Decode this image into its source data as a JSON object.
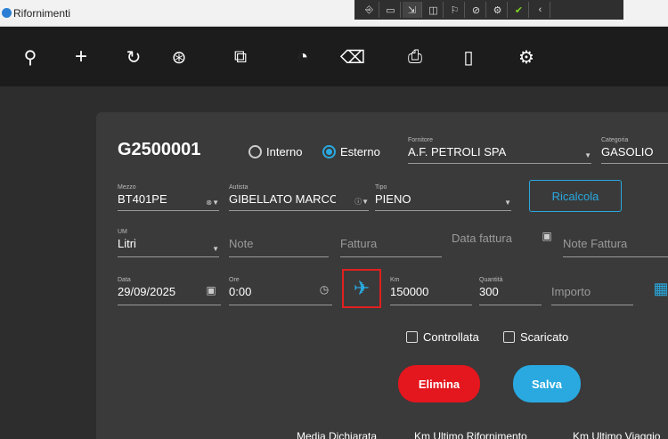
{
  "window": {
    "title": "Rifornimenti"
  },
  "tray": {
    "items": [
      "⎆",
      "▭",
      "⇲",
      "◫",
      "⚐",
      "⊘",
      "⚙",
      "✔",
      "‹"
    ]
  },
  "toolbar": {
    "search_icon": "⚲",
    "add_icon": "+",
    "refresh_icon": "↻",
    "copy_icon": "⊛",
    "attach_icon": "⧉",
    "history_icon": "◔",
    "trash_icon": "⌫",
    "print_icon": "⎙",
    "mobile_icon": "▯",
    "settings_icon": "⚙"
  },
  "form": {
    "code": "G2500001",
    "type_options": [
      "Interno",
      "Esterno"
    ],
    "type_selected": "Esterno",
    "fornitore": {
      "label": "Fornitore",
      "value": "A.F. PETROLI SPA"
    },
    "categoria": {
      "label": "Categoria",
      "value": "GASOLIO"
    },
    "mezzo": {
      "label": "Mezzo",
      "value": "BT401PE"
    },
    "autista": {
      "label": "Autista",
      "value": "GIBELLATO MARCO"
    },
    "tipo": {
      "label": "Tipo",
      "value": "PIENO"
    },
    "ricalcola_label": "Ricalcola",
    "um": {
      "label": "UM",
      "value": "Litri"
    },
    "note_placeholder": "Note",
    "fattura_placeholder": "Fattura",
    "data_fattura_placeholder": "Data fattura",
    "note_fattura_placeholder": "Note Fattura",
    "data": {
      "label": "Data",
      "value": "29/09/2025"
    },
    "ore": {
      "label": "Ore",
      "value": "0:00"
    },
    "km": {
      "label": "Km",
      "value": "150000"
    },
    "quantita": {
      "label": "Quantità",
      "value": "300"
    },
    "importo_placeholder": "Importo",
    "controllata_label": "Controllata",
    "scaricato_label": "Scaricato",
    "elimina_label": "Elimina",
    "salva_label": "Salva"
  },
  "footer": {
    "media": "Media Dichiarata",
    "km_ultimo": "Km Ultimo Rifornimento",
    "km_ultimo_viaggio": "Km Ultimo Viaggio"
  },
  "colors": {
    "accent": "#29a9e0",
    "danger": "#e4161e",
    "highlight": "#e02020"
  }
}
